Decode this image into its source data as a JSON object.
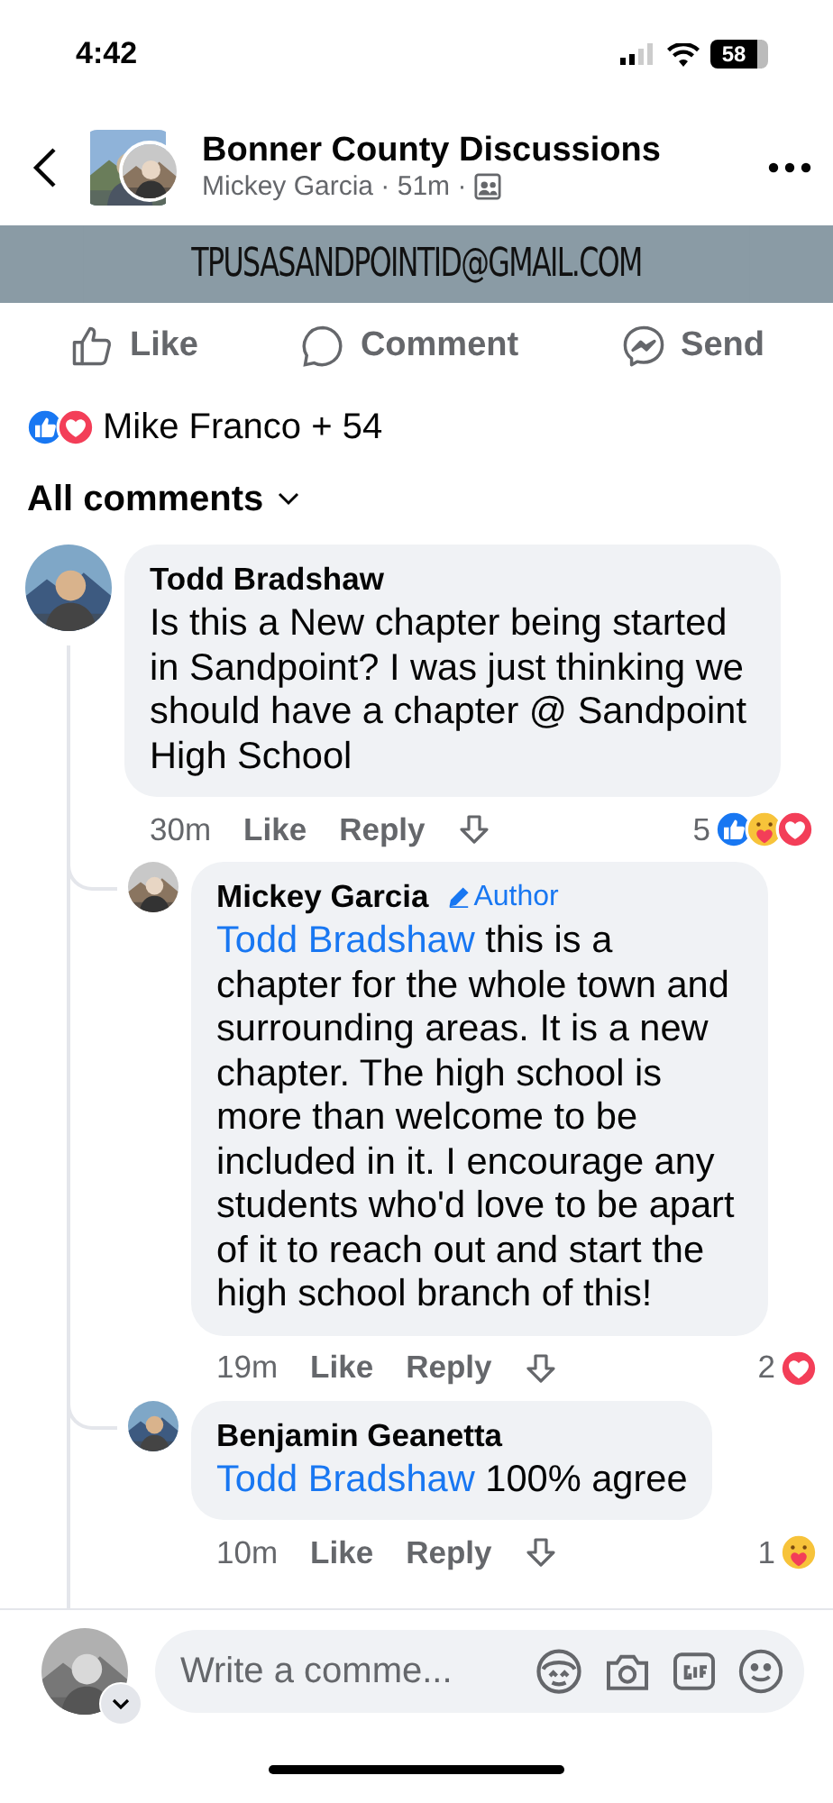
{
  "status_bar": {
    "time": "4:42",
    "battery": "58"
  },
  "header": {
    "title": "Bonner County Discussions",
    "meta": "Mickey Garcia · 51m ·"
  },
  "post_banner": {
    "text": "TPUSASANDPOINTID@GMAIL.COM"
  },
  "actions": [
    {
      "kind": "like",
      "label": "Like"
    },
    {
      "kind": "comment",
      "label": "Comment"
    },
    {
      "kind": "send",
      "label": "Send"
    }
  ],
  "reactions_summary": {
    "reactions": [
      {
        "kind": "like"
      },
      {
        "kind": "love"
      }
    ],
    "text": "Mike Franco + 54"
  },
  "sort": {
    "label": "All comments"
  },
  "comments": [
    {
      "author": "Todd Bradshaw",
      "text": "Is this a New chapter being started in Sandpoint? I was just thinking we should have a chapter @ Sandpoint High School",
      "time": "30m",
      "like": "Like",
      "reply": "Reply",
      "reaction_count": "5",
      "reactions": [
        {
          "kind": "like"
        },
        {
          "kind": "care"
        },
        {
          "kind": "love"
        }
      ],
      "replies": [
        {
          "author": "Mickey Garcia",
          "badge": "Author",
          "mention": "Todd Bradshaw",
          "text": "this is a chapter for the whole town and surrounding areas. It is a new chapter. The high school is more than welcome to be included in it. I encourage any students who'd love to be apart of it to reach out and start the high school branch of this!",
          "time": "19m",
          "like": "Like",
          "reply": "Reply",
          "reaction_count": "2",
          "reactions": [
            {
              "kind": "love"
            }
          ]
        },
        {
          "author": "Benjamin Geanetta",
          "mention": "Todd Bradshaw",
          "text": "100% agree",
          "time": "10m",
          "like": "Like",
          "reply": "Reply",
          "reaction_count": "1",
          "reactions": [
            {
              "kind": "care"
            }
          ]
        }
      ]
    }
  ],
  "composer": {
    "placeholder": "Write a comme..."
  }
}
